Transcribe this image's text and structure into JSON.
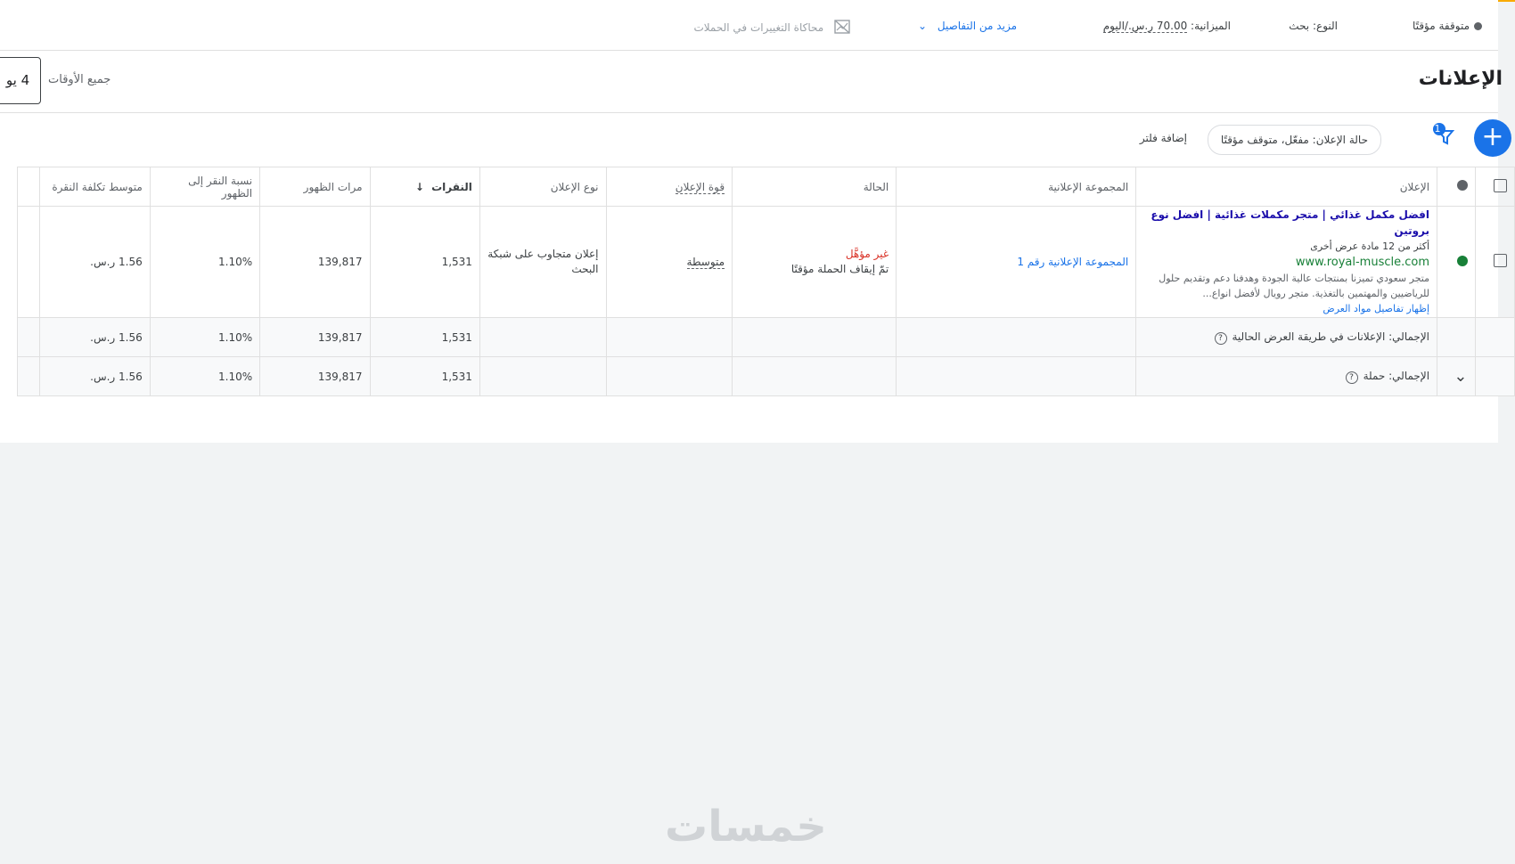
{
  "summary": {
    "status": "متوقفة مؤقتًا",
    "type_label": "النوع:",
    "type_value": "بحث",
    "budget_label": "الميزانية:",
    "budget_value": "70.00 ر.س./اليوم",
    "more_details": "مزيد من التفاصيل",
    "currency_sim": "محاكاة التغييرات في الحملات"
  },
  "header": {
    "title": "الإعلانات",
    "date_range_label": "جميع الأوقات",
    "date_button": "4 يو"
  },
  "filters": {
    "filter_count": "1",
    "chip": "حالة الإعلان: مفعّل، متوقف مؤقتًا",
    "add_filter": "إضافة فلتر"
  },
  "table": {
    "columns": {
      "ad": "الإعلان",
      "ad_group": "المجموعة الإعلانية",
      "status": "الحالة",
      "ad_strength": "قوة الإعلان",
      "ad_type": "نوع الإعلان",
      "clicks": "النقرات",
      "impressions": "مرات الظهور",
      "ctr": "نسبة النقر إلى الظهور",
      "avg_cpc": "متوسط تكلفة النقرة"
    },
    "row": {
      "headline": "افضل مكمل غذائي | متجر مكملات غذائية | افضل نوع بروتين",
      "more_assets": "أكثر من 12 مادة عرض أخرى",
      "url": "www.royal-muscle.com",
      "description": "متجر سعودي تميزنا بمنتجات عالية الجودة وهدفنا دعم وتقديم حلول للرياضيين والمهتمين بالتغذية. متجر رويال لأفضل انواع...",
      "show_details": "إظهار تفاصيل مواد العرض",
      "ad_group": "المجموعة الإعلانية رقم 1",
      "status": "غير مؤهَّل",
      "status_detail": "تمّ إيقاف الحملة مؤقتًا",
      "ad_strength": "متوسطة",
      "ad_type": "إعلان متجاوب على شبكة البحث",
      "clicks": "1,531",
      "impressions": "139,817",
      "ctr": "1.10%",
      "avg_cpc": "1.56 ر.س."
    },
    "totals": [
      {
        "label": "الإجمالي: الإعلانات في طريقة العرض الحالية",
        "clicks": "1,531",
        "impressions": "139,817",
        "ctr": "1.10%",
        "avg_cpc": "1.56 ر.س."
      },
      {
        "label": "الإجمالي: حملة",
        "clicks": "1,531",
        "impressions": "139,817",
        "ctr": "1.10%",
        "avg_cpc": "1.56 ر.س."
      }
    ]
  },
  "watermark": "خمسات",
  "colors": {
    "accent": "#1a73e8",
    "warning_bar": "#f9ab00",
    "enabled": "#188038",
    "error": "#d93025"
  }
}
